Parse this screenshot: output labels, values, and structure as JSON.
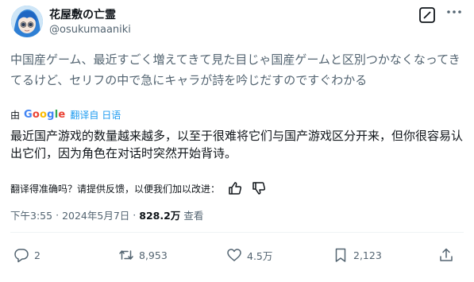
{
  "header": {
    "display_name": "花屋敷の亡霊",
    "handle": "@osukumaaniki",
    "avatar_icon": "anime-avatar",
    "grok_icon": "grok-icon",
    "more_icon": "more-dots-icon"
  },
  "post": {
    "original_text": "中国産ゲーム、最近すごく増えてきて見た目じゃ国産ゲームと区別つかなくなってきてるけど、セリフの中で急にキャラが詩を吟じだすのですぐわかる",
    "translated_by_prefix": "由",
    "translated_by_brand": "Google",
    "translate_link": "翻译自 日语",
    "translated_text": "最近国产游戏的数量越来越多，以至于很难将它们与国产游戏区分开来，但你很容易认出它们，因为角色在对话时突然开始背诗。",
    "feedback_text": "翻译得准确吗？请提供反馈，以便我们加以改进："
  },
  "meta": {
    "time": "下午3:55",
    "separator": "·",
    "date": "2024年5月7日",
    "views_count": "828.2万",
    "views_label": "查看"
  },
  "actions": {
    "replies": "2",
    "reposts": "8,953",
    "likes": "4.5万",
    "bookmarks": "2,123"
  },
  "colors": {
    "text": "#0f1419",
    "muted": "#536471",
    "link": "#1d9bf0",
    "divider": "#eff3f4"
  }
}
